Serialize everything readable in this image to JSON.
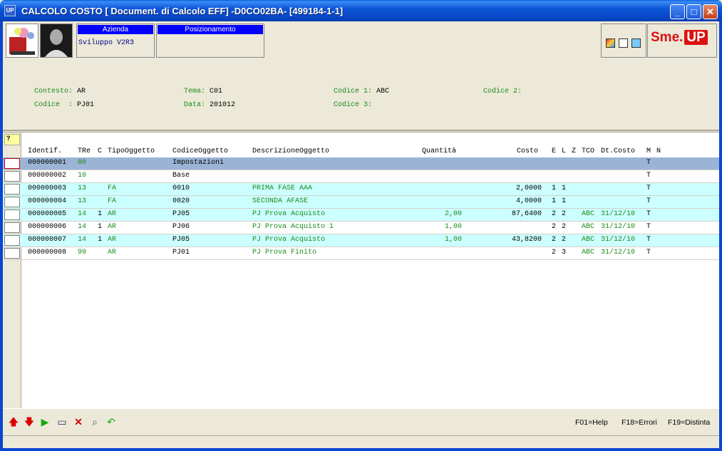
{
  "window": {
    "title": "CALCOLO COSTO [ Document. di Calcolo EFF] -D0CO02BA- [499184-1-1]",
    "app_icon_text": "UP",
    "minimize": "_",
    "maximize": "□",
    "close": "✕"
  },
  "header": {
    "azienda_label": "Azienda",
    "azienda_value": "Sviluppo V2R3",
    "posizionamento_label": "Posizionamento",
    "posizionamento_value": "",
    "brand_sme": "Sme.",
    "brand_up": "UP"
  },
  "context": {
    "contesto_label": "Contesto:",
    "contesto_value": "AR",
    "tema_label": "Tema:",
    "tema_value": "C01",
    "codice1_label": "Codice 1:",
    "codice1_value": "ABC",
    "codice2_label": "Codice 2:",
    "codice2_value": "",
    "codice_label": "Codice  :",
    "codice_value": "PJ01",
    "data_label": "Data:",
    "data_value": "201012",
    "codice3_label": "Codice 3:",
    "codice3_value": ""
  },
  "grid": {
    "corner": "?",
    "columns": {
      "identif": "Identif.",
      "tre": "TRe",
      "c": "C",
      "tipo": "TipoOggetto",
      "codice": "CodiceOggetto",
      "descr": "DescrizioneOggetto",
      "quantita": "Quantità",
      "costo": "Costo",
      "e": "E",
      "l": "L",
      "z": "Z",
      "tco": "TCO",
      "dtcosto": "Dt.Costo",
      "m": "M",
      "n": "N"
    },
    "rows": [
      {
        "identif": "000000001",
        "tre": "00",
        "c": "",
        "tipo": "",
        "codice": "Impostazioni",
        "descr": "",
        "quantita": "",
        "costo": "",
        "e": "",
        "l": "",
        "tco": "",
        "dtcosto": "",
        "m": "T"
      },
      {
        "identif": "000000002",
        "tre": "10",
        "c": "",
        "tipo": "",
        "codice": "Base",
        "descr": "",
        "quantita": "",
        "costo": "",
        "e": "",
        "l": "",
        "tco": "",
        "dtcosto": "",
        "m": "T"
      },
      {
        "identif": "000000003",
        "tre": "13",
        "c": "",
        "tipo": "FA",
        "codice": "0010",
        "descr": "PRIMA FASE AAA",
        "quantita": "",
        "costo": "2,0000",
        "e": "1",
        "l": "1",
        "tco": "",
        "dtcosto": "",
        "m": "T"
      },
      {
        "identif": "000000004",
        "tre": "13",
        "c": "",
        "tipo": "FA",
        "codice": "0020",
        "descr": "SECONDA AFASE",
        "quantita": "",
        "costo": "4,0000",
        "e": "1",
        "l": "1",
        "tco": "",
        "dtcosto": "",
        "m": "T"
      },
      {
        "identif": "000000005",
        "tre": "14",
        "c": "1",
        "tipo": "AR",
        "codice": "PJ05",
        "descr": "PJ Prova Acquisto",
        "quantita": "2,00",
        "costo": "87,6400",
        "e": "2",
        "l": "2",
        "tco": "ABC",
        "dtcosto": "31/12/10",
        "m": "T"
      },
      {
        "identif": "000000006",
        "tre": "14",
        "c": "1",
        "tipo": "AR",
        "codice": "PJ06",
        "descr": "PJ Prova Acquisto 1",
        "quantita": "1,00",
        "costo": "",
        "e": "2",
        "l": "2",
        "tco": "ABC",
        "dtcosto": "31/12/10",
        "m": "T"
      },
      {
        "identif": "000000007",
        "tre": "14",
        "c": "1",
        "tipo": "AR",
        "codice": "PJ05",
        "descr": "PJ Prova Acquisto",
        "quantita": "1,00",
        "costo": "43,8200",
        "e": "2",
        "l": "2",
        "tco": "ABC",
        "dtcosto": "31/12/10",
        "m": "T"
      },
      {
        "identif": "000000008",
        "tre": "99",
        "c": "",
        "tipo": "AR",
        "codice": "PJ01",
        "descr": "PJ Prova Finito",
        "quantita": "",
        "costo": "",
        "e": "2",
        "l": "3",
        "tco": "ABC",
        "dtcosto": "31/12/10",
        "m": "T"
      }
    ]
  },
  "footer": {
    "icons": [
      "arrow-up-icon",
      "arrow-down-icon",
      "play-icon",
      "link-icon",
      "delete-icon",
      "search-icon",
      "refresh-icon"
    ],
    "f01": "F01=Help",
    "f18": "F18=Errori",
    "f19": "F19=Distinta"
  }
}
